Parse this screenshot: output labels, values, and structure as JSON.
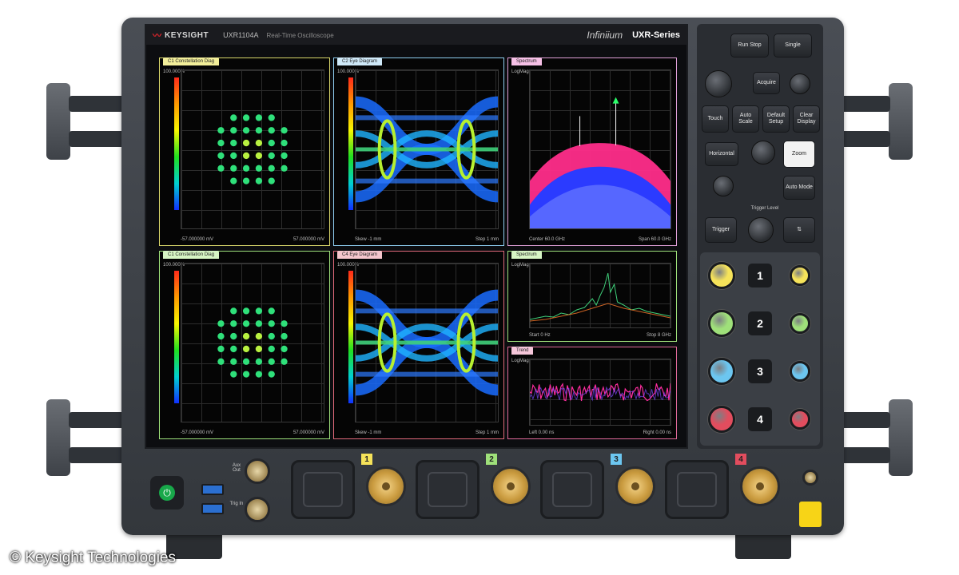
{
  "header": {
    "brand": "KEYSIGHT",
    "model": "UXR1104A",
    "subtitle": "Real-Time Oscilloscope",
    "product_family": "Infiniium",
    "series": "UXR-Series"
  },
  "panels": {
    "p1": {
      "tab": "C1  Constellation Diag",
      "y_label": "100.000%",
      "foot_left": "-57.000000 mV",
      "foot_right": "57.000000 mV"
    },
    "p2": {
      "tab": "C2  Eye Diagram",
      "y_label": "100.000%",
      "foot_left": "Skew -1 mm",
      "foot_right": "Step 1 mm"
    },
    "p3": {
      "tab": "Spectrum",
      "y_label": "LogMag",
      "foot_left": "Center 60.0 GHz",
      "foot_right": "Span 60.0 GHz"
    },
    "p4": {
      "tab": "C1  Constellation Diag",
      "y_label": "100.000%",
      "foot_left": "-57.000000 mV",
      "foot_right": "57.000000 mV"
    },
    "p5": {
      "tab": "C4  Eye Diagram",
      "y_label": "100.000%",
      "foot_left": "Skew -1 mm",
      "foot_right": "Step 1 mm"
    },
    "p6": {
      "tab": "Spectrum",
      "y_label": "LogMag",
      "foot_left": "Start 0 Hz",
      "foot_right": "Stop 8 GHz"
    },
    "p7": {
      "tab": "Trend",
      "y_label": "LogMag",
      "foot_left": "Left 0.00 ns",
      "foot_right": "Right 0.00 ns"
    }
  },
  "controls": {
    "run_stop": "Run Stop",
    "single": "Single",
    "touch": "Touch",
    "auto_scale": "Auto Scale",
    "default_setup": "Default Setup",
    "clear_display": "Clear Display",
    "horizontal": "Horizontal",
    "acquire": "Acquire",
    "zoom": "Zoom",
    "trigger_level": "Trigger Level",
    "auto_mode": "Auto Mode",
    "trigger": "Trigger",
    "channels": [
      "1",
      "2",
      "3",
      "4"
    ]
  },
  "front": {
    "channel_inputs": [
      "1",
      "2",
      "3",
      "4"
    ],
    "aux_labels": [
      "Aux Out",
      "Trig In"
    ]
  },
  "caption": "© Keysight Technologies",
  "colors": {
    "ch1": "#f6e35a",
    "ch2": "#9fe07a",
    "ch3": "#6cc6f0",
    "ch4": "#e24d5e",
    "accent": "#e0252b"
  }
}
